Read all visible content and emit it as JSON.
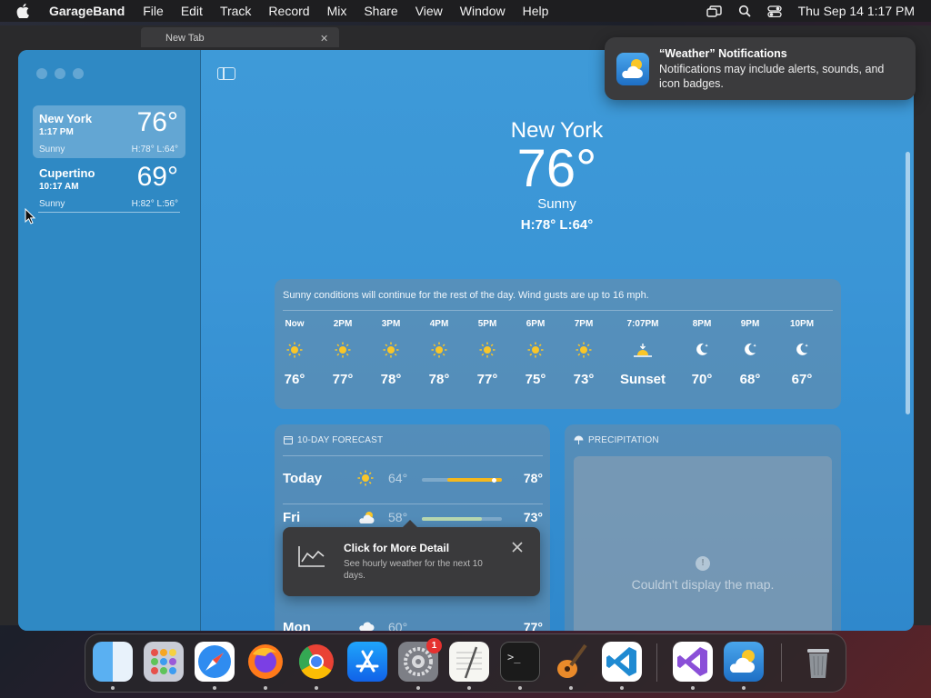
{
  "menubar": {
    "app": "GarageBand",
    "items": [
      "File",
      "Edit",
      "Track",
      "Record",
      "Mix",
      "Share",
      "View",
      "Window",
      "Help"
    ],
    "datetime": "Thu Sep 14  1:17 PM"
  },
  "background_tab": {
    "title": "New Tab"
  },
  "sidebar": {
    "locations": [
      {
        "name": "New York",
        "time": "1:17 PM",
        "temp": "76°",
        "condition": "Sunny",
        "hilo": "H:78°  L:64°"
      },
      {
        "name": "Cupertino",
        "time": "10:17 AM",
        "temp": "69°",
        "condition": "Sunny",
        "hilo": "H:82°  L:56°"
      }
    ]
  },
  "current": {
    "city": "New York",
    "temp": "76°",
    "condition": "Sunny",
    "hilo": "H:78°  L:64°"
  },
  "hourly": {
    "summary": "Sunny conditions will continue for the rest of the day. Wind gusts are up to 16 mph.",
    "hours": [
      {
        "label": "Now",
        "icon": "sun-icon",
        "temp": "76°"
      },
      {
        "label": "2PM",
        "icon": "sun-icon",
        "temp": "77°"
      },
      {
        "label": "3PM",
        "icon": "sun-icon",
        "temp": "78°"
      },
      {
        "label": "4PM",
        "icon": "sun-icon",
        "temp": "78°"
      },
      {
        "label": "5PM",
        "icon": "sun-icon",
        "temp": "77°"
      },
      {
        "label": "6PM",
        "icon": "sun-icon",
        "temp": "75°"
      },
      {
        "label": "7PM",
        "icon": "sun-icon",
        "temp": "73°"
      },
      {
        "label": "7:07PM",
        "icon": "sunset-icon",
        "temp": "Sunset"
      },
      {
        "label": "8PM",
        "icon": "moon-icon",
        "temp": "70°"
      },
      {
        "label": "9PM",
        "icon": "moon-icon",
        "temp": "68°"
      },
      {
        "label": "10PM",
        "icon": "moon-icon",
        "temp": "67°"
      }
    ]
  },
  "forecast": {
    "title": "10-DAY FORECAST",
    "days": [
      {
        "day": "Today",
        "icon": "sun-icon",
        "low": "64°",
        "high": "78°"
      },
      {
        "day": "Fri",
        "icon": "partly-cloudy-icon",
        "low": "58°",
        "high": "73°"
      },
      {
        "day": "Mon",
        "icon": "cloud-icon",
        "low": "60°",
        "high": "77°"
      }
    ]
  },
  "precipitation": {
    "title": "PRECIPITATION",
    "message": "Couldn't display the map."
  },
  "tooltip": {
    "title": "Click for More Detail",
    "body": "See hourly weather for the next 10 days."
  },
  "notification": {
    "title": "“Weather” Notifications",
    "body": "Notifications may include alerts, sounds, and icon badges."
  },
  "dock": {
    "apps": [
      "Finder",
      "Launchpad",
      "Safari",
      "Firefox",
      "Chrome",
      "App Store",
      "System Settings",
      "TextEdit",
      "Terminal",
      "GarageBand",
      "Visual Studio Code",
      "Visual Studio",
      "Weather",
      "Trash"
    ],
    "settings_badge": "1"
  }
}
